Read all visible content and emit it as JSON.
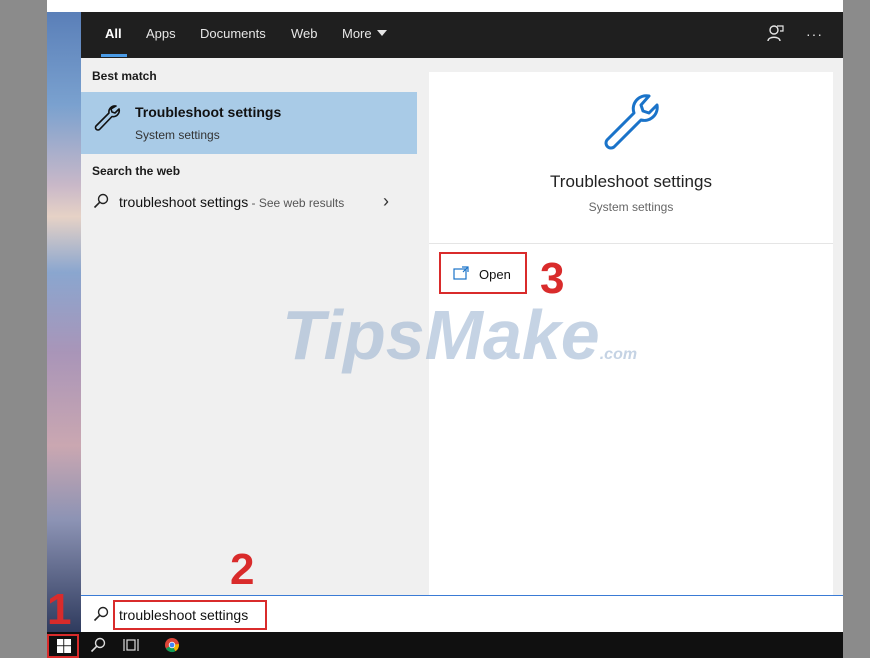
{
  "tabs": [
    {
      "label": "All",
      "active": true
    },
    {
      "label": "Apps"
    },
    {
      "label": "Documents"
    },
    {
      "label": "Web"
    },
    {
      "label": "More"
    }
  ],
  "header_icons": {
    "feedback": "feedback-icon",
    "more": "···"
  },
  "best_match": {
    "heading": "Best match",
    "title": "Troubleshoot settings",
    "subtitle": "System settings",
    "icon": "wrench-icon"
  },
  "search_web": {
    "heading": "Search the web",
    "query": "troubleshoot settings",
    "suffix": " - See web results"
  },
  "preview": {
    "title": "Troubleshoot settings",
    "subtitle": "System settings",
    "open_label": "Open"
  },
  "search_box": {
    "value": "troubleshoot settings"
  },
  "steps": {
    "one": "1",
    "two": "2",
    "three": "3"
  },
  "watermark": {
    "main": "TipsMake",
    "domain": ".com"
  },
  "colors": {
    "accent": "#a9cbe7",
    "highlight": "#d92b2b",
    "icon_blue": "#1a73c9"
  }
}
